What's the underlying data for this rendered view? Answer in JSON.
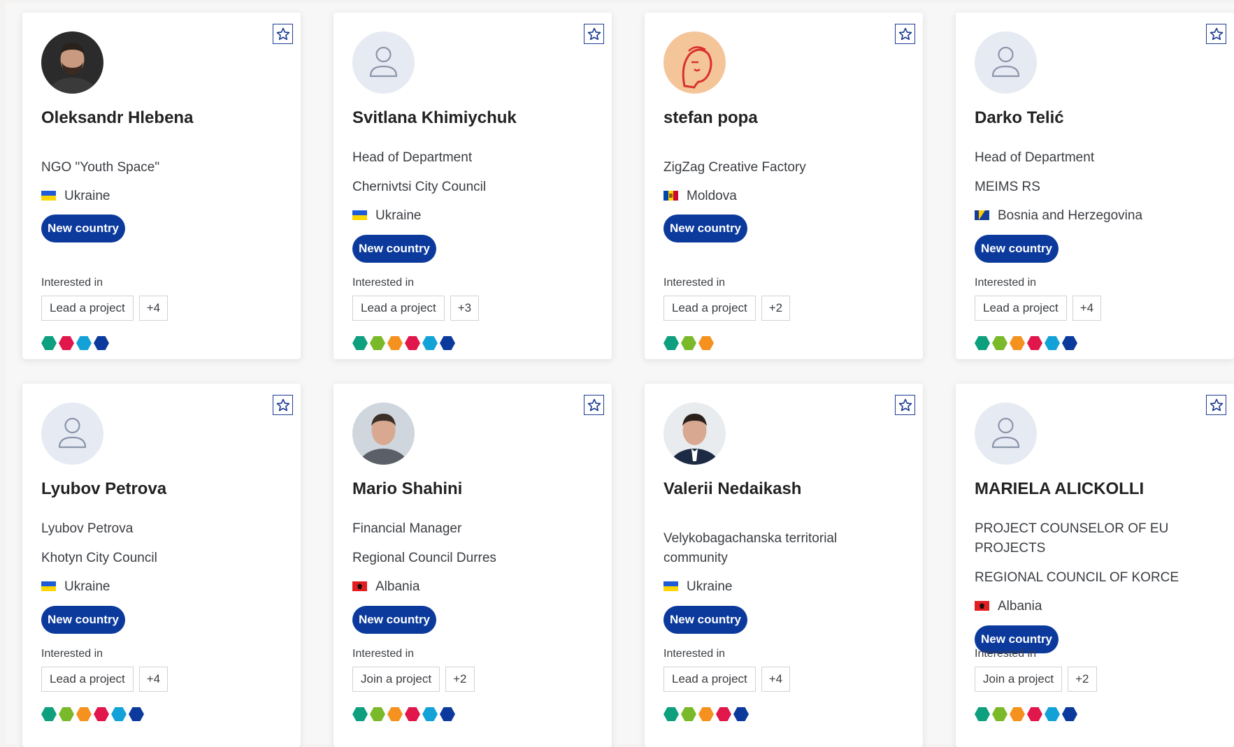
{
  "colors": {
    "badge": "#0b3a9c",
    "star": "#1c3b93",
    "topic": {
      "teal": "#0e9f7e",
      "green": "#7ab929",
      "orange": "#f5911e",
      "red": "#e1164a",
      "cyan": "#13a2d8",
      "navy": "#0b3a9c"
    }
  },
  "labels": {
    "interested_in": "Interested in",
    "new_country": "New country"
  },
  "cards": [
    {
      "name": "Oleksandr Hlebena",
      "avatar": "photo-man-beard",
      "lines": [
        "NGO \"Youth Space\""
      ],
      "country": "Ukraine",
      "flag": "flag-ua",
      "badge": "New country",
      "tags": [
        "Lead a project",
        "+4"
      ],
      "dots": [
        "teal",
        "red",
        "cyan",
        "navy"
      ]
    },
    {
      "name": "Svitlana Khimiychuk",
      "avatar": "placeholder-user-icon",
      "lines": [
        "Head of Department",
        "Chernivtsi City Council"
      ],
      "country": "Ukraine",
      "flag": "flag-ua",
      "badge": "New country",
      "tags": [
        "Lead a project",
        "+3"
      ],
      "dots": [
        "teal",
        "green",
        "orange",
        "red",
        "cyan",
        "navy"
      ]
    },
    {
      "name": "stefan popa",
      "avatar": "illustration-portrait",
      "lines": [
        "ZigZag Creative Factory"
      ],
      "country": "Moldova",
      "flag": "flag-md",
      "badge": "New country",
      "tags": [
        "Lead a project",
        "+2"
      ],
      "dots": [
        "teal",
        "green",
        "orange"
      ]
    },
    {
      "name": "Darko Telić",
      "avatar": "placeholder-user-icon",
      "lines": [
        "Head of Department",
        "MEIMS RS"
      ],
      "country": "Bosnia and Herzegovina",
      "flag": "flag-ba",
      "badge": "New country",
      "tags": [
        "Lead a project",
        "+4"
      ],
      "dots": [
        "teal",
        "green",
        "orange",
        "red",
        "cyan",
        "navy"
      ]
    },
    {
      "name": "Lyubov Petrova",
      "avatar": "placeholder-user-icon",
      "lines": [
        "Lyubov Petrova",
        "Khotyn City Council"
      ],
      "country": "Ukraine",
      "flag": "flag-ua",
      "badge": "New country",
      "tags": [
        "Lead a project",
        "+4"
      ],
      "dots": [
        "teal",
        "green",
        "orange",
        "red",
        "cyan",
        "navy"
      ]
    },
    {
      "name": "Mario Shahini",
      "avatar": "photo-man-light",
      "lines": [
        "Financial Manager",
        "Regional Council Durres"
      ],
      "country": "Albania",
      "flag": "flag-al",
      "badge": "New country",
      "tags": [
        "Join a project",
        "+2"
      ],
      "dots": [
        "teal",
        "green",
        "orange",
        "red",
        "cyan",
        "navy"
      ]
    },
    {
      "name": "Valerii Nedaikash",
      "avatar": "photo-man-suit",
      "lines": [
        "Velykobagachanska territorial community"
      ],
      "country": "Ukraine",
      "flag": "flag-ua",
      "badge": "New country",
      "tags": [
        "Lead a project",
        "+4"
      ],
      "dots": [
        "teal",
        "green",
        "orange",
        "red",
        "navy"
      ]
    },
    {
      "name": "MARIELA ALICKOLLI",
      "avatar": "placeholder-user-icon",
      "lines": [
        "PROJECT COUNSELOR OF EU PROJECTS",
        "REGIONAL COUNCIL OF KORCE"
      ],
      "country": "Albania",
      "flag": "flag-al",
      "badge": "New country",
      "tags": [
        "Join a project",
        "+2"
      ],
      "dots": [
        "teal",
        "green",
        "orange",
        "red",
        "cyan",
        "navy"
      ]
    }
  ]
}
